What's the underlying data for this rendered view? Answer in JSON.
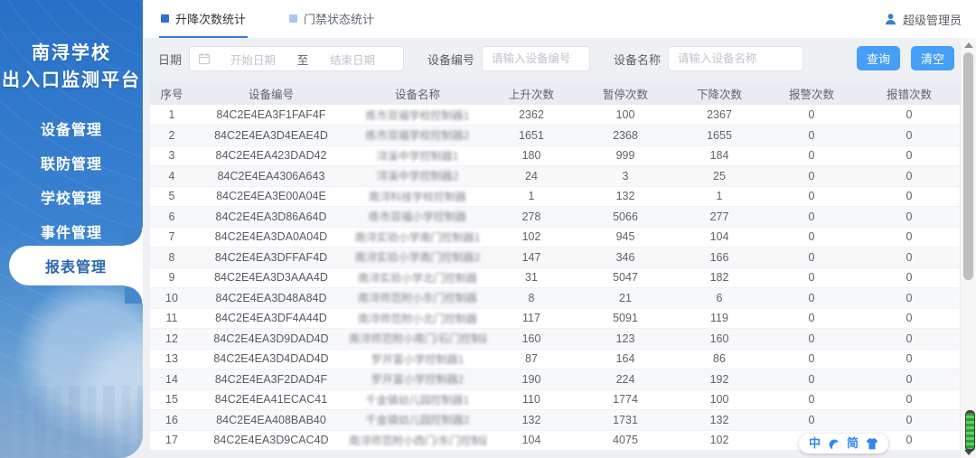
{
  "colors": {
    "accent": "#3a7bd5",
    "button_blue": "#469ff6",
    "sidebar_blue": "#2770c7",
    "active_text": "#2c66ad"
  },
  "sidebar": {
    "title_line1": "南浔学校",
    "title_line2": "出入口监测平台",
    "items": [
      {
        "label": "设备管理",
        "active": false
      },
      {
        "label": "联防管理",
        "active": false
      },
      {
        "label": "学校管理",
        "active": false
      },
      {
        "label": "事件管理",
        "active": false
      },
      {
        "label": "报表管理",
        "active": true
      }
    ]
  },
  "header": {
    "tabs": [
      {
        "label": "升降次数统计",
        "active": true
      },
      {
        "label": "门禁状态统计",
        "active": false
      }
    ],
    "user": "超级管理员"
  },
  "filters": {
    "date_label": "日期",
    "start_placeholder": "开始日期",
    "range_separator": "至",
    "end_placeholder": "结束日期",
    "device_no_label": "设备编号",
    "device_no_placeholder": "请输入设备编号",
    "device_name_label": "设备名称",
    "device_name_placeholder": "请输入设备名称",
    "search_button": "查询",
    "clear_button": "清空"
  },
  "table": {
    "columns": [
      "序号",
      "设备编号",
      "设备名称",
      "上升次数",
      "暂停次数",
      "下降次数",
      "报警次数",
      "报错次数"
    ],
    "rows": [
      [
        1,
        "84C2E4EA3F1FAF4F",
        "练市双福学校控制器1",
        2362,
        100,
        2367,
        0,
        0
      ],
      [
        2,
        "84C2E4EA3D4EAE4D",
        "练市双福学校控制器2",
        1651,
        2368,
        1655,
        0,
        0
      ],
      [
        3,
        "84C2E4EA423DAD42",
        "浔溪中学控制器1",
        180,
        999,
        184,
        0,
        0
      ],
      [
        4,
        "84C2E4EA4306A643",
        "浔溪中学控制器2",
        24,
        3,
        25,
        0,
        0
      ],
      [
        5,
        "84C2E4EA3E00A04E",
        "南浔科技学校控制器",
        1,
        132,
        1,
        0,
        0
      ],
      [
        6,
        "84C2E4EA3D86A64D",
        "练市双福小学控制器",
        278,
        5066,
        277,
        0,
        0
      ],
      [
        7,
        "84C2E4EA3DA0A04D",
        "南浔实验小学南门控制器1",
        102,
        945,
        104,
        0,
        0
      ],
      [
        8,
        "84C2E4EA3DFFAF4D",
        "南浔实验小学南门控制器2",
        147,
        346,
        166,
        0,
        0
      ],
      [
        9,
        "84C2E4EA3D3AAA4D",
        "南浔实验小学北门控制器",
        31,
        5047,
        182,
        0,
        0
      ],
      [
        10,
        "84C2E4EA3D48A84D",
        "南浔师范附小东门控制器",
        8,
        21,
        6,
        0,
        0
      ],
      [
        11,
        "84C2E4EA3DF4A44D",
        "南浔师范附小北门控制器",
        117,
        5091,
        119,
        0,
        0
      ],
      [
        12,
        "84C2E4EA3D9DAD4D",
        "南浔师范附小南门/石门控制器1",
        160,
        123,
        160,
        0,
        0
      ],
      [
        13,
        "84C2E4EA3D4DAD4D",
        "罗开富小学控制器1",
        87,
        164,
        86,
        0,
        0
      ],
      [
        14,
        "84C2E4EA3F2DAD4F",
        "罗开富小学控制器2",
        190,
        224,
        192,
        0,
        0
      ],
      [
        15,
        "84C2E4EA41ECAC41",
        "千金镇幼儿园控制器1",
        110,
        1774,
        100,
        0,
        0
      ],
      [
        16,
        "84C2E4EA408BAB40",
        "千金镇幼儿园控制器2",
        132,
        1731,
        132,
        0,
        0
      ],
      [
        17,
        "84C2E4EA3D9CAC4D",
        "南浔师范附小西门/东门控制器2",
        104,
        4075,
        102,
        0,
        0
      ]
    ]
  },
  "ime_widget": {
    "lang": "中",
    "mode": "简"
  }
}
